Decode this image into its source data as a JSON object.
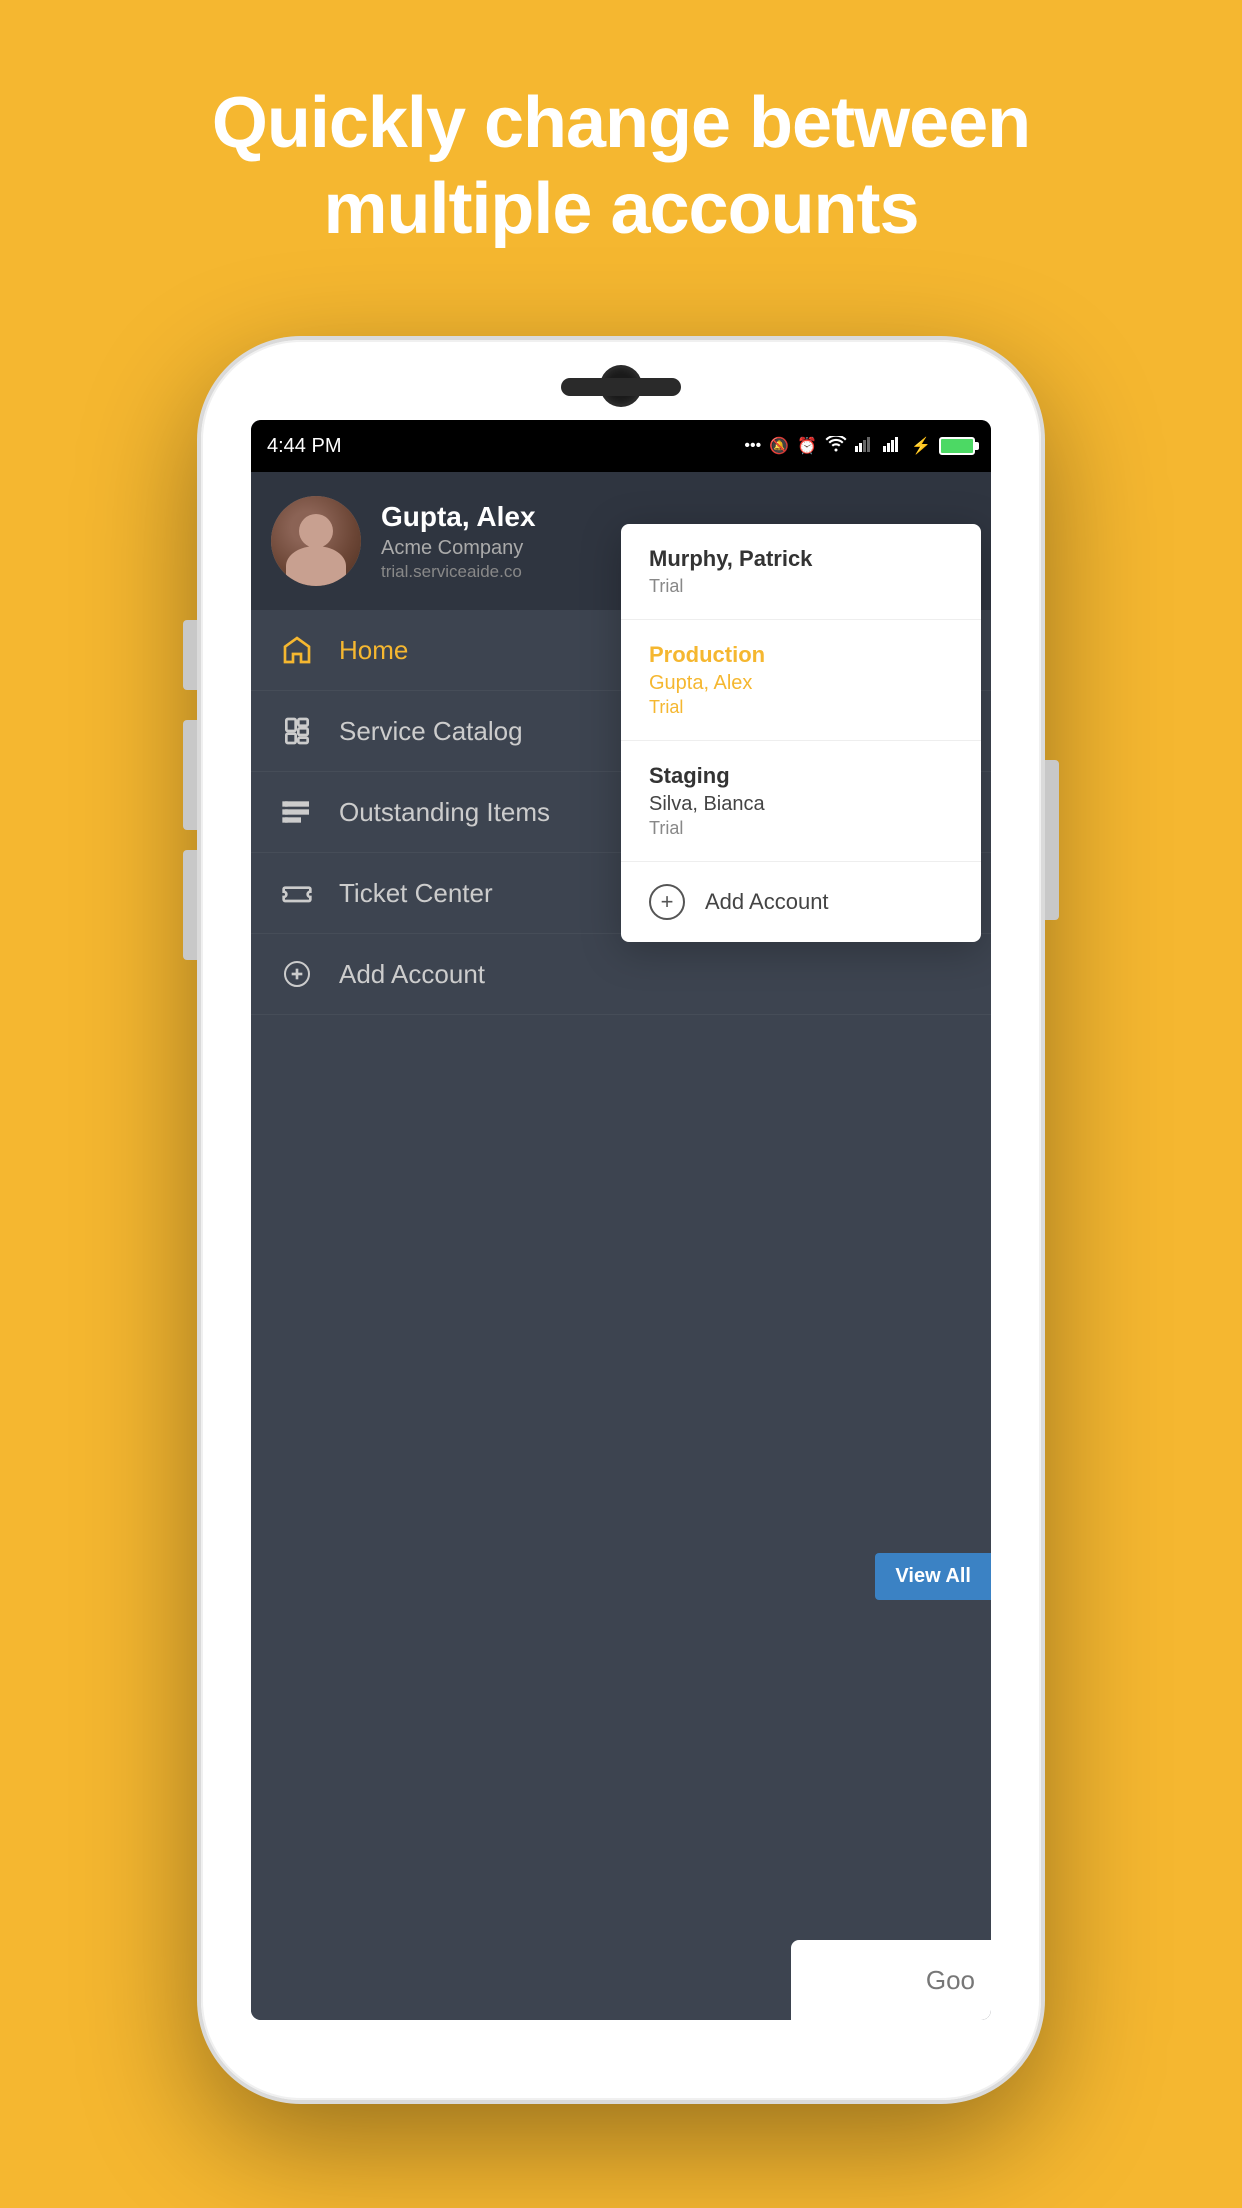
{
  "headline": {
    "line1": "Quickly change between",
    "line2": "multiple accounts"
  },
  "status_bar": {
    "time": "4:44 PM",
    "icons": [
      "...",
      "🔕",
      "⏰",
      "wifi",
      "signal1",
      "signal2",
      "battery"
    ]
  },
  "user_profile": {
    "name": "Gupta, Alex",
    "company": "Acme Company",
    "url": "trial.serviceaide.co"
  },
  "nav_items": [
    {
      "id": "home",
      "label": "Home",
      "active": true,
      "icon": "home"
    },
    {
      "id": "service-catalog",
      "label": "Service Catalog",
      "active": false,
      "icon": "catalog"
    },
    {
      "id": "outstanding-items",
      "label": "Outstanding Items",
      "active": false,
      "icon": "list"
    },
    {
      "id": "ticket-center",
      "label": "Ticket Center",
      "active": false,
      "icon": "ticket"
    },
    {
      "id": "add-account",
      "label": "Add Account",
      "active": false,
      "icon": "add-circle"
    }
  ],
  "dropdown": {
    "accounts": [
      {
        "id": "murphy",
        "env_name": "Murphy, Patrick",
        "user_name": "",
        "tier": "Trial",
        "active": false
      },
      {
        "id": "production",
        "env_name": "Production",
        "user_name": "Gupta, Alex",
        "tier": "Trial",
        "active": true
      },
      {
        "id": "staging",
        "env_name": "Staging",
        "user_name": "Silva, Bianca",
        "tier": "Trial",
        "active": false
      }
    ],
    "add_account_label": "Add Account"
  },
  "view_all_label": "View All",
  "google_partial": "Goo"
}
